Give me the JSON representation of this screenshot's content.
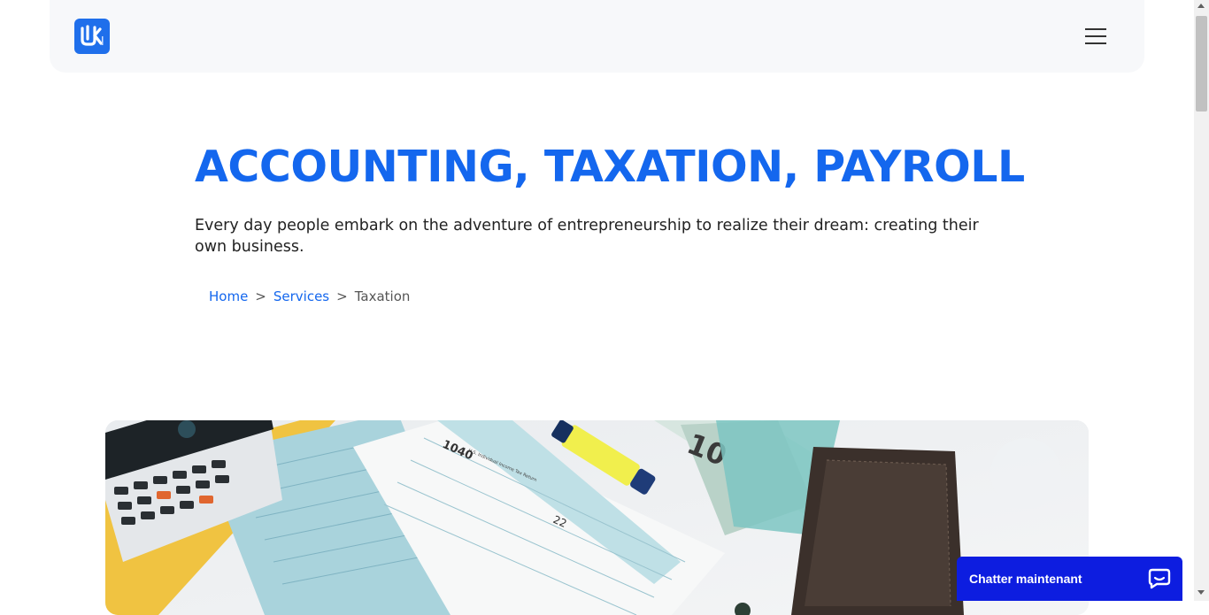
{
  "header": {
    "logo_icon": "uh-logo-icon",
    "menu_icon": "hamburger-menu-icon"
  },
  "hero": {
    "title": "ACCOUNTING, TAXATION, PAYROLL",
    "intro": "Every day people embark on the adventure of entrepreneurship to realize their dream: creating their own business."
  },
  "breadcrumb": {
    "home": "Home",
    "services": "Services",
    "current": "Taxation",
    "separator": ">"
  },
  "image": {
    "form_number": "1040",
    "form_header": "U.S. Individual Income Tax Return",
    "line_number": "22",
    "banknote_number": "10"
  },
  "chat": {
    "label": "Chatter maintenant",
    "icon": "chat-bubble-icon"
  },
  "colors": {
    "accent": "#1467ee",
    "chat_button": "#0d1de0",
    "header_bg": "#f7f8fa"
  }
}
